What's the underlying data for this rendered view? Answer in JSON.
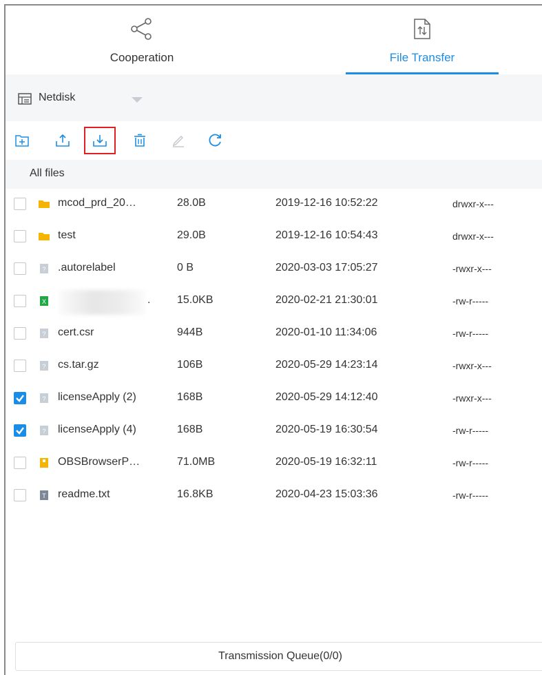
{
  "tabs": [
    {
      "label": "Cooperation",
      "icon": "share-icon",
      "active": false
    },
    {
      "label": "File Transfer",
      "icon": "file-transfer-icon",
      "active": true
    }
  ],
  "colors": {
    "accent": "#1a8de6",
    "highlight": "#e02020",
    "folder": "#f5b400",
    "excel": "#21a846",
    "archive": "#f5b400"
  },
  "source": {
    "label": "Netdisk",
    "icon": "netdisk-icon"
  },
  "toolbar": {
    "buttons": [
      {
        "name": "new-folder-icon"
      },
      {
        "name": "upload-icon"
      },
      {
        "name": "download-icon",
        "highlighted": true
      },
      {
        "name": "delete-icon"
      },
      {
        "name": "rename-icon",
        "disabled": true
      },
      {
        "name": "refresh-icon"
      }
    ]
  },
  "breadcrumb": "All files",
  "files": [
    {
      "name": "mcod_prd_20…",
      "size": "28.0B",
      "date": "2019-12-16 10:52:22",
      "perm": "drwxr-x---",
      "type": "folder",
      "checked": false
    },
    {
      "name": "test",
      "size": "29.0B",
      "date": "2019-12-16 10:54:43",
      "perm": "drwxr-x---",
      "type": "folder",
      "checked": false
    },
    {
      "name": ".autorelabel",
      "size": "0 B",
      "date": "2020-03-03 17:05:27",
      "perm": "-rwxr-x---",
      "type": "unknown",
      "checked": false
    },
    {
      "name": ".",
      "size": "15.0KB",
      "date": "2020-02-21 21:30:01",
      "perm": "-rw-r-----",
      "type": "excel",
      "checked": false,
      "redacted": true
    },
    {
      "name": "cert.csr",
      "size": "944B",
      "date": "2020-01-10 11:34:06",
      "perm": "-rw-r-----",
      "type": "unknown",
      "checked": false
    },
    {
      "name": "cs.tar.gz",
      "size": "106B",
      "date": "2020-05-29 14:23:14",
      "perm": "-rwxr-x---",
      "type": "unknown",
      "checked": false
    },
    {
      "name": "licenseApply (2)",
      "size": "168B",
      "date": "2020-05-29 14:12:40",
      "perm": "-rwxr-x---",
      "type": "unknown",
      "checked": true
    },
    {
      "name": "licenseApply (4)",
      "size": "168B",
      "date": "2020-05-19 16:30:54",
      "perm": "-rw-r-----",
      "type": "unknown",
      "checked": true
    },
    {
      "name": "OBSBrowserP…",
      "size": "71.0MB",
      "date": "2020-05-19 16:32:11",
      "perm": "-rw-r-----",
      "type": "archive",
      "checked": false
    },
    {
      "name": "readme.txt",
      "size": "16.8KB",
      "date": "2020-04-23 15:03:36",
      "perm": "-rw-r-----",
      "type": "text",
      "checked": false
    }
  ],
  "queue_label": "Transmission Queue(0/0)"
}
